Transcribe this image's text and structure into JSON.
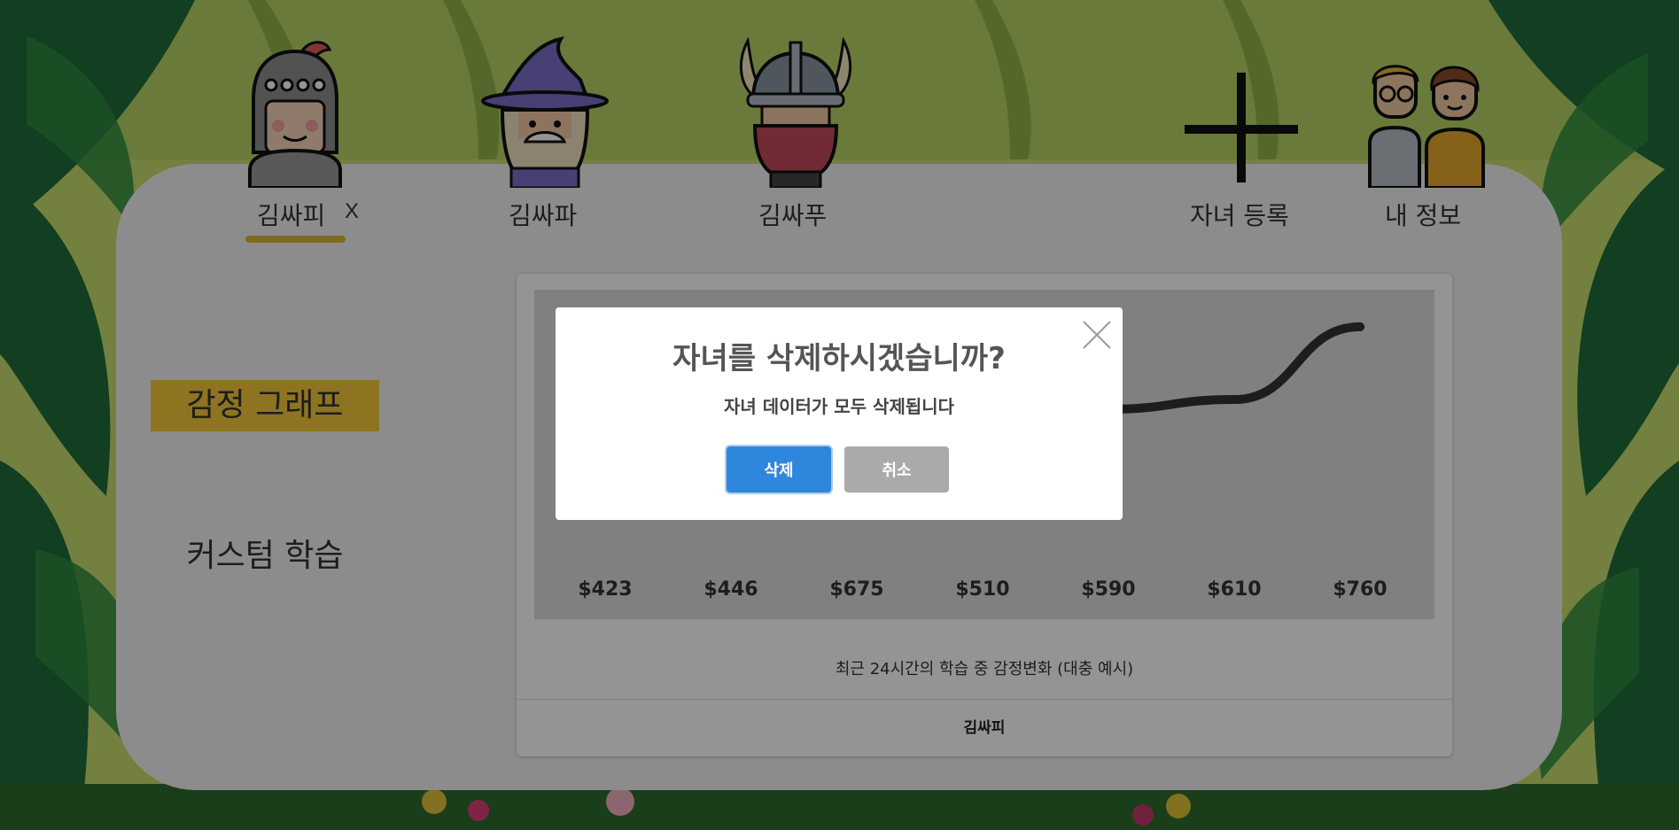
{
  "nav": {
    "children": [
      {
        "name": "김싸피",
        "active": true,
        "remove_label": "X",
        "avatar": "knight-avatar-icon"
      },
      {
        "name": "김싸파",
        "avatar": "wizard-avatar-icon"
      },
      {
        "name": "김싸푸",
        "avatar": "viking-avatar-icon"
      }
    ],
    "add_child": {
      "label": "자녀 등록",
      "icon": "plus-icon"
    },
    "my_info": {
      "label": "내 정보",
      "icon": "parents-icon"
    }
  },
  "sidebar": {
    "emotion_graph": "감정 그래프",
    "custom_learning": "커스텀 학습"
  },
  "card": {
    "caption": "최근 24시간의 학습 중 감정변화 (대충 예시)",
    "footer": "김싸피"
  },
  "chart_data": {
    "type": "line",
    "categories": [
      "$423",
      "$446",
      "$675",
      "$510",
      "$590",
      "$610",
      "$760"
    ],
    "values": [
      423,
      446,
      675,
      510,
      590,
      610,
      760
    ],
    "ylim": [
      380,
      800
    ],
    "title": "",
    "xlabel": "",
    "ylabel": "",
    "grid": false,
    "line_color": "#333333"
  },
  "modal": {
    "title": "자녀를 삭제하시겠습니까?",
    "message": "자녀 데이터가 모두 삭제됩니다",
    "confirm_label": "삭제",
    "cancel_label": "취소",
    "close_icon": "close-icon"
  },
  "colors": {
    "accent_yellow": "#f4c63a",
    "primary_blue": "#2f86dd",
    "cancel_gray": "#aaaaaa",
    "panel_bg": "#f2f2f2"
  }
}
